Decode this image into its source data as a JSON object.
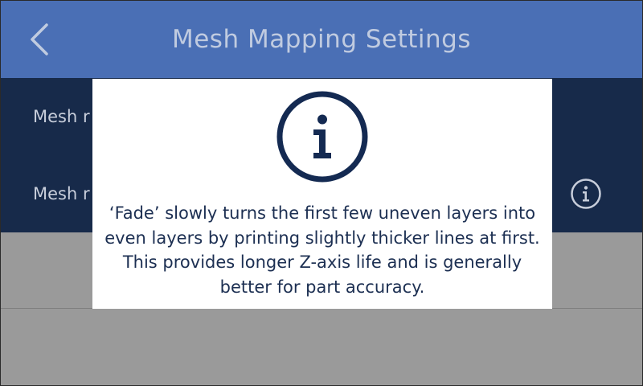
{
  "header": {
    "title": "Mesh Mapping Settings",
    "back_icon": "chevron-left-icon"
  },
  "settings": {
    "rows": [
      {
        "label": "Mesh r"
      },
      {
        "label": "Mesh r",
        "info_icon": "info-circle-icon"
      }
    ]
  },
  "modal": {
    "icon": "info-circle-icon",
    "message": "‘Fade’ slowly turns the first few uneven layers into even layers by printing slightly thicker lines at first. This provides longer Z-axis life and is generally better for part accuracy."
  },
  "colors": {
    "header_bg": "#4a6fb5",
    "list_bg": "#172a4a",
    "modal_bg": "#ffffff",
    "modal_text": "#1c2f52",
    "backdrop_gray": "#9a9a9a"
  }
}
